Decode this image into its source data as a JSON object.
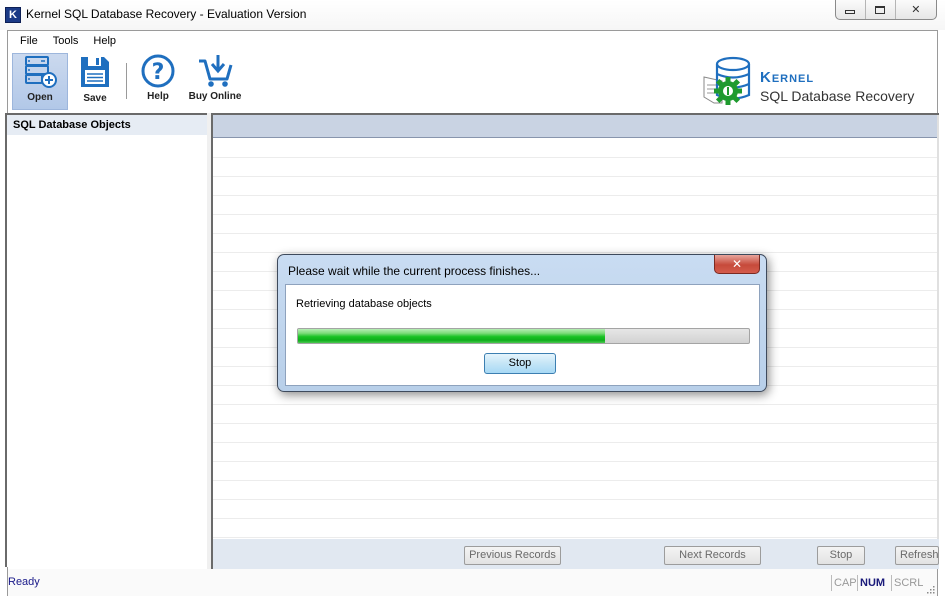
{
  "window": {
    "title": "Kernel SQL Database Recovery - Evaluation Version",
    "app_icon_letter": "K",
    "controls": {
      "minimize": "minimize",
      "maximize": "maximize",
      "close": "✕"
    }
  },
  "menu": [
    {
      "label": "File"
    },
    {
      "label": "Tools"
    },
    {
      "label": "Help"
    }
  ],
  "toolbar": {
    "open_label": "Open",
    "save_label": "Save",
    "help_label": "Help",
    "buy_label": "Buy Online"
  },
  "brand": {
    "name": "Kernel",
    "product": "SQL Database Recovery",
    "accent": "#1f6fbf",
    "gear_color": "#1f9a2f"
  },
  "left_pane": {
    "header": "SQL Database Objects"
  },
  "grid": {
    "row_count": 21,
    "footer_buttons": {
      "previous": "Previous Records",
      "next": "Next Records",
      "stop": "Stop",
      "refresh": "Refresh"
    }
  },
  "status_bar": {
    "text": "Ready",
    "cap": "CAP",
    "num": "NUM",
    "scrl": "SCRL"
  },
  "dialog": {
    "title": "Please wait while the current process finishes...",
    "close": "✕",
    "message": "Retrieving database objects",
    "progress_percent": 68,
    "stop_label": "Stop"
  }
}
